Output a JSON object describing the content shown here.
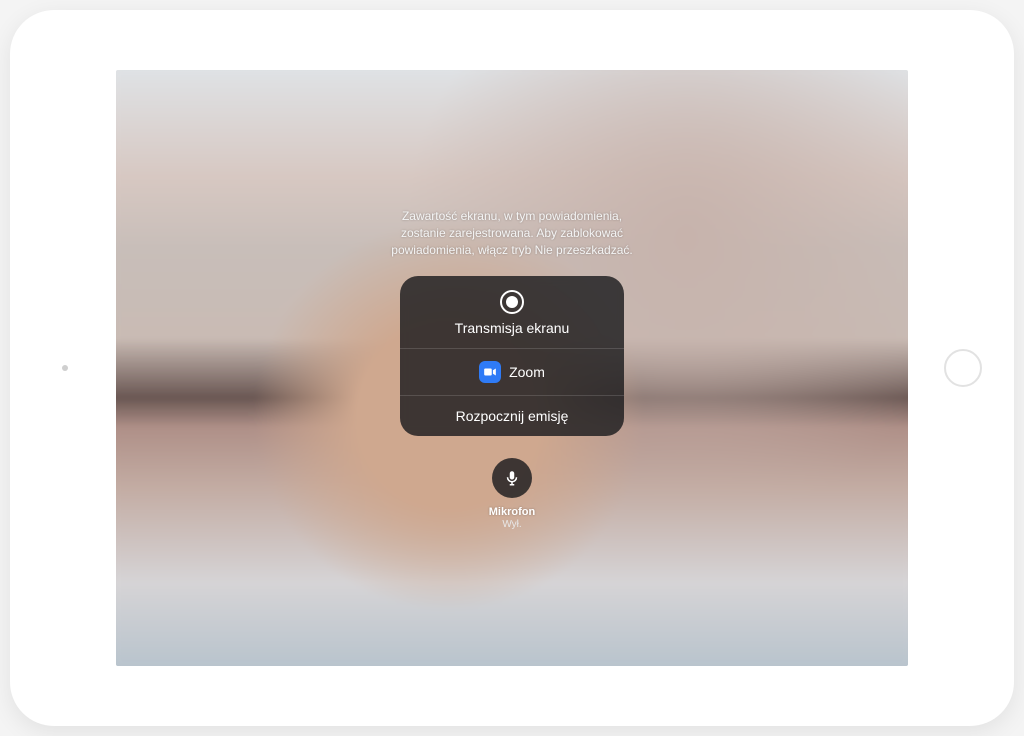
{
  "info_text": "Zawartość ekranu, w tym powiadomienia,\nzostanie zarejestrowana. Aby zablokować\npowiadomienia, włącz tryb Nie przeszkadzać.",
  "panel": {
    "title": "Transmisja ekranu",
    "target_app": "Zoom",
    "start_label": "Rozpocznij emisję"
  },
  "microphone": {
    "label": "Mikrofon",
    "status": "Wył."
  }
}
